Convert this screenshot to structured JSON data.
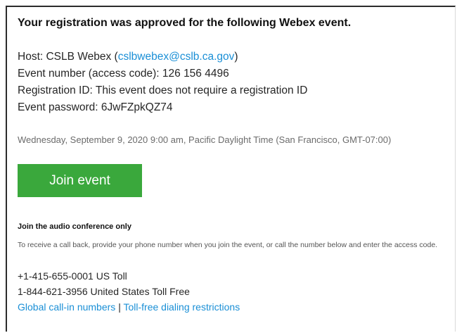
{
  "email": {
    "heading": "Your registration was approved for the following Webex event.",
    "host_label": "Host: CSLB Webex (",
    "host_email": "cslbwebex@cslb.ca.gov",
    "host_suffix": ")",
    "event_number": "Event number (access code): 126 156 4496",
    "registration_id": "Registration ID: This event does not require a registration ID",
    "event_password": "Event password: 6JwFZpkQZ74",
    "datetime": "Wednesday, September 9, 2020 9:00 am, Pacific Daylight Time (San Francisco, GMT-07:00)",
    "join_button": "Join event",
    "audio_title": "Join the audio conference only",
    "audio_desc": "To receive a call back, provide your phone number when you join the event, or call the number below and enter the access code.",
    "phone_toll": "+1-415-655-0001 US Toll",
    "phone_tollfree": "1-844-621-3956 United States Toll Free",
    "link_global": "Global call-in numbers",
    "link_separator": "|",
    "link_restrictions": "Toll-free dialing restrictions"
  },
  "colors": {
    "link": "#1a8fd6",
    "button": "#3aa83c",
    "muted_text": "#6b6b6b"
  }
}
